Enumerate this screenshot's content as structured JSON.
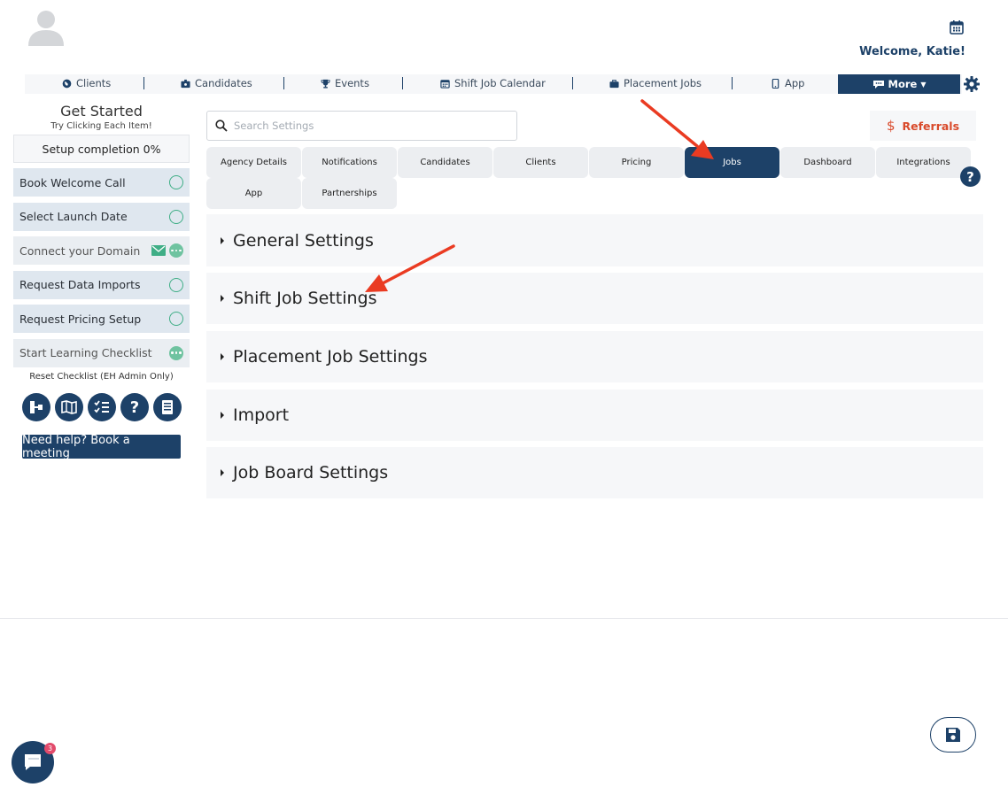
{
  "header": {
    "welcome": "Welcome, Katie!"
  },
  "nav": {
    "items": [
      {
        "label": "Clients",
        "icon": "globe-icon"
      },
      {
        "label": "Candidates",
        "icon": "id-badge-icon"
      },
      {
        "label": "Events",
        "icon": "trophy-icon"
      },
      {
        "label": "Shift Job Calendar",
        "icon": "calendar-icon"
      },
      {
        "label": "Placement Jobs",
        "icon": "briefcase-icon"
      },
      {
        "label": "App",
        "icon": "phone-icon"
      }
    ],
    "more": "More"
  },
  "sidebar": {
    "title": "Get Started",
    "subtitle": "Try Clicking Each Item!",
    "progress": "Setup completion 0%",
    "items": [
      {
        "label": "Book Welcome Call"
      },
      {
        "label": "Select Launch Date"
      },
      {
        "label": "Connect your Domain"
      },
      {
        "label": "Request Data Imports"
      },
      {
        "label": "Request Pricing Setup"
      },
      {
        "label": "Start Learning Checklist"
      }
    ],
    "reset": "Reset Checklist (EH Admin Only)",
    "help": "Need help? Book a meeting"
  },
  "search": {
    "placeholder": "Search Settings"
  },
  "referrals": {
    "label": "Referrals"
  },
  "tabs": [
    "Agency Details",
    "Notifications",
    "Candidates",
    "Clients",
    "Pricing",
    "Jobs",
    "Dashboard",
    "Integrations",
    "App",
    "Partnerships"
  ],
  "active_tab": "Jobs",
  "sections": [
    "General Settings",
    "Shift Job Settings",
    "Placement Job Settings",
    "Import",
    "Job Board Settings"
  ],
  "chat": {
    "badge": "3"
  },
  "colors": {
    "primary": "#1d4168",
    "accent": "#d94a2b",
    "success": "#3fae86",
    "arrow": "#ea3b22"
  }
}
